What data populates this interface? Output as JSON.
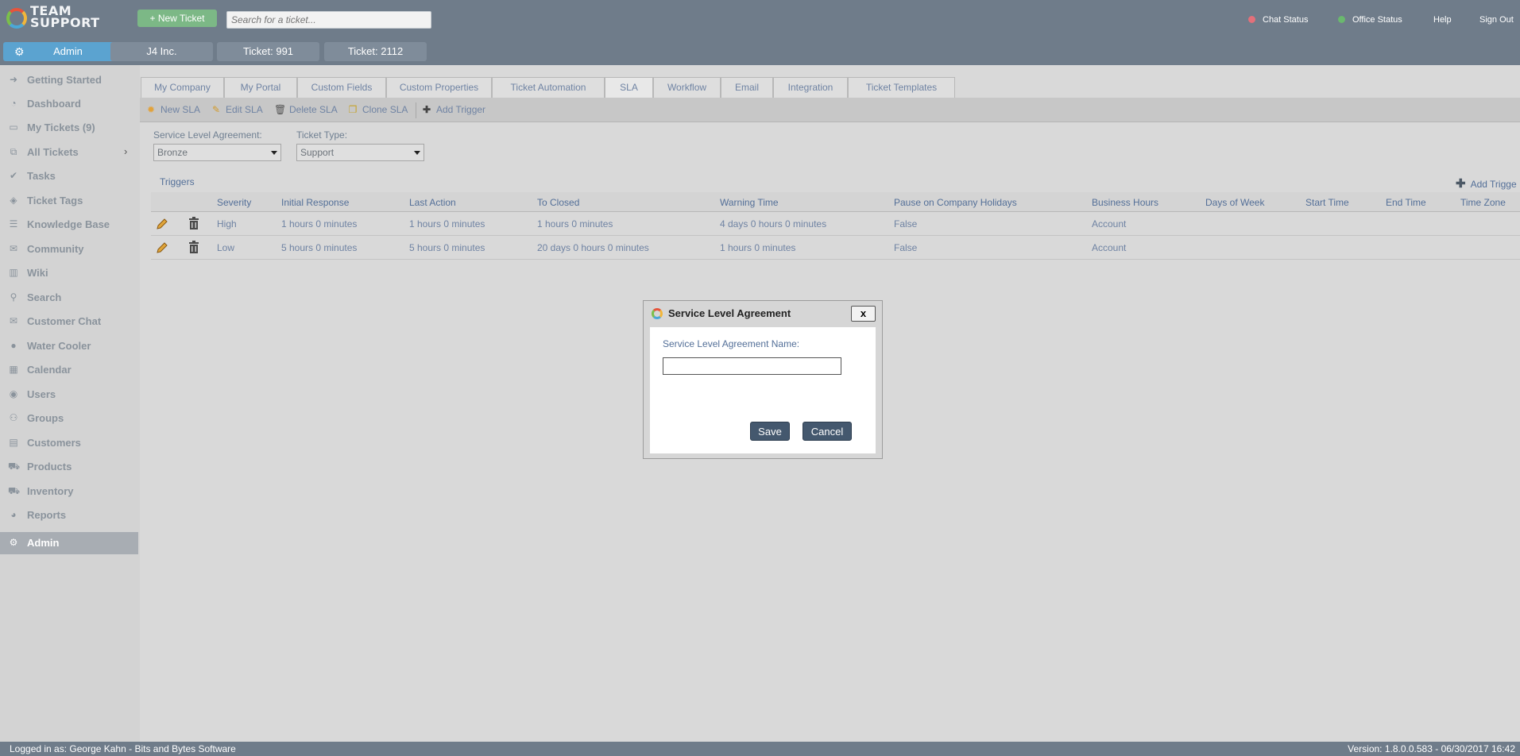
{
  "header": {
    "logo_line1": "TEAM",
    "logo_line2": "SUPPORT",
    "new_ticket_label": "+ New Ticket",
    "search_placeholder": "Search for a ticket...",
    "chat_status": "Chat Status",
    "office_status": "Office Status",
    "help": "Help",
    "sign_out": "Sign Out",
    "chat_status_color": "#e3707a",
    "office_status_color": "#6ab86e"
  },
  "open_tabs": [
    {
      "label": "Admin",
      "icon": "gear-icon",
      "active": true
    },
    {
      "label": "J4 Inc."
    },
    {
      "label": "Ticket: 991"
    },
    {
      "label": "Ticket: 2112"
    }
  ],
  "sidebar": {
    "items": [
      {
        "label": "Getting Started",
        "icon": "arrow-icon"
      },
      {
        "label": "Dashboard",
        "icon": "gauge-icon"
      },
      {
        "label": "My Tickets (9)",
        "icon": "monitor-icon"
      },
      {
        "label": "All Tickets",
        "icon": "tickets-icon"
      },
      {
        "label": "Tasks",
        "icon": "check-icon"
      },
      {
        "label": "Ticket Tags",
        "icon": "tag-icon"
      },
      {
        "label": "Knowledge Base",
        "icon": "stack-icon"
      },
      {
        "label": "Community",
        "icon": "chat-icon"
      },
      {
        "label": "Wiki",
        "icon": "book-icon"
      },
      {
        "label": "Search",
        "icon": "search-icon"
      },
      {
        "label": "Customer Chat",
        "icon": "chat-bubbles-icon"
      },
      {
        "label": "Water Cooler",
        "icon": "drop-icon"
      },
      {
        "label": "Calendar",
        "icon": "calendar-icon"
      },
      {
        "label": "Users",
        "icon": "user-icon"
      },
      {
        "label": "Groups",
        "icon": "group-icon"
      },
      {
        "label": "Customers",
        "icon": "building-icon"
      },
      {
        "label": "Products",
        "icon": "cart-icon"
      },
      {
        "label": "Inventory",
        "icon": "truck-icon"
      },
      {
        "label": "Reports",
        "icon": "pie-icon"
      },
      {
        "label": "Admin",
        "icon": "gear-icon",
        "active": true
      }
    ]
  },
  "admin_tabs": [
    "My Company",
    "My Portal",
    "Custom Fields",
    "Custom Properties",
    "Ticket Automation",
    "SLA",
    "Workflow",
    "Email",
    "Integration",
    "Ticket Templates"
  ],
  "active_admin_tab": "SLA",
  "toolbar": {
    "new_sla": "New SLA",
    "edit_sla": "Edit SLA",
    "delete_sla": "Delete SLA",
    "clone_sla": "Clone SLA",
    "add_trigger": "Add Trigger"
  },
  "filters": {
    "sla_label": "Service Level Agreement:",
    "sla_value": "Bronze",
    "ticket_type_label": "Ticket Type:",
    "ticket_type_value": "Support"
  },
  "triggers": {
    "title": "Triggers",
    "add_label": "Add Trigge",
    "columns": [
      "Severity",
      "Initial Response",
      "Last Action",
      "To Closed",
      "Warning Time",
      "Pause on Company Holidays",
      "Business Hours",
      "Days of Week",
      "Start Time",
      "End Time",
      "Time Zone"
    ],
    "rows": [
      [
        "High",
        "1 hours 0 minutes",
        "1 hours 0 minutes",
        "1 hours 0 minutes",
        "4 days 0 hours 0 minutes",
        "False",
        "Account",
        "",
        "",
        "",
        ""
      ],
      [
        "Low",
        "5 hours 0 minutes",
        "5 hours 0 minutes",
        "20 days 0 hours 0 minutes",
        "1 hours 0 minutes",
        "False",
        "Account",
        "",
        "",
        "",
        ""
      ]
    ]
  },
  "dialog": {
    "title": "Service Level Agreement",
    "close_label": "x",
    "field_label": "Service Level Agreement Name:",
    "field_value": "",
    "save_label": "Save",
    "cancel_label": "Cancel"
  },
  "footer": {
    "logged_in": "Logged in as: George Kahn - Bits and Bytes Software",
    "version": "Version: 1.8.0.0.583 - 06/30/2017 16:42"
  }
}
